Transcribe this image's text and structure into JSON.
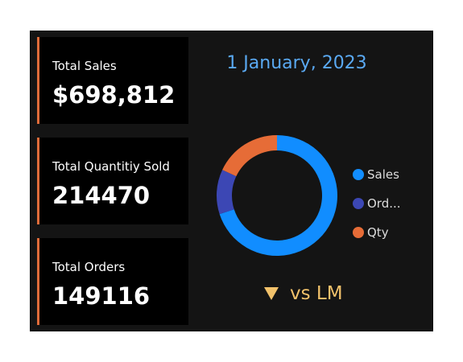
{
  "cards": [
    {
      "label": "Total Sales",
      "value": "$698,812"
    },
    {
      "label": "Total Quantitiy Sold",
      "value": "214470"
    },
    {
      "label": "Total Orders",
      "value": "149116"
    }
  ],
  "date_label": "1 January, 2023",
  "comparison_label": "vs LM",
  "comparison_direction": "down",
  "colors": {
    "accent": "#e06c3a",
    "date": "#5aa9f2",
    "comparison": "#f2c26b",
    "panel_background": "#141414",
    "card_background": "#000000"
  },
  "chart_data": {
    "type": "pie",
    "style": "donut",
    "legend_position": "right",
    "series": [
      {
        "name": "Sales",
        "legend_label": "Sales",
        "value": 0.7,
        "color": "#118dff"
      },
      {
        "name": "Orders",
        "legend_label": "Ord...",
        "value": 0.12,
        "color": "#3c47b4"
      },
      {
        "name": "Qty",
        "legend_label": "Qty",
        "value": 0.18,
        "color": "#e66c37"
      }
    ]
  }
}
